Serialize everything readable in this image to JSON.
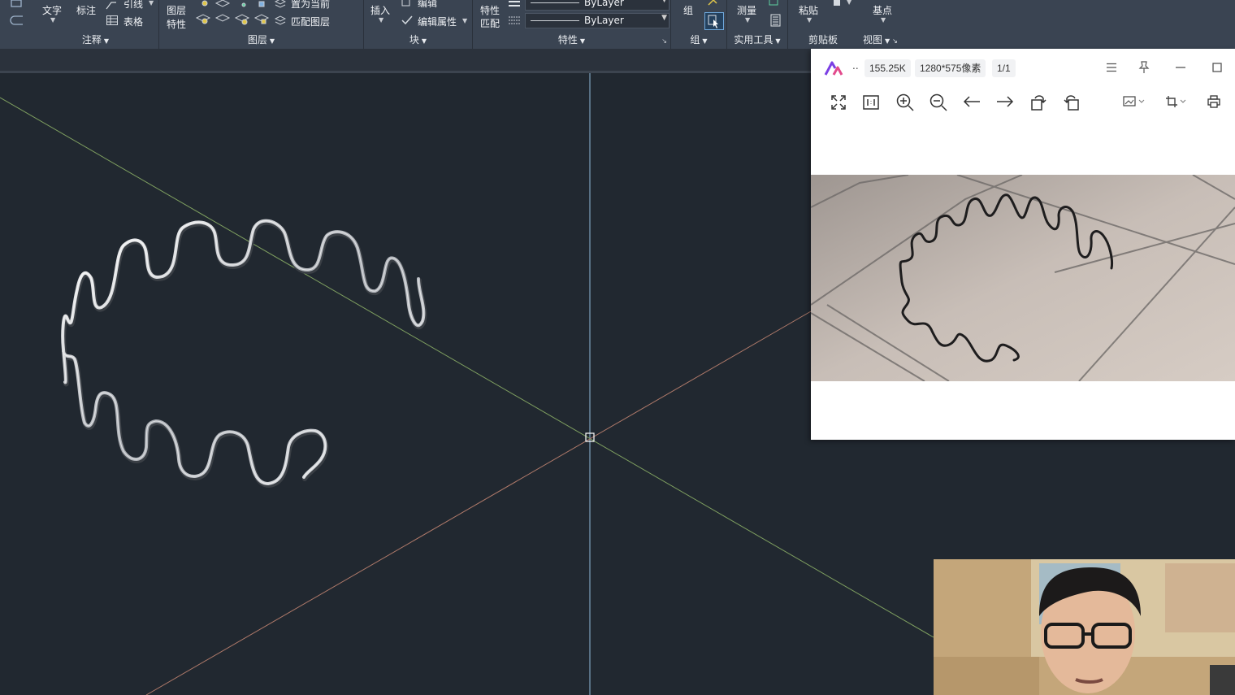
{
  "ribbon": {
    "annotation": {
      "text_label": "文字",
      "dim_label": "标注",
      "leader_label": "引线",
      "table_label": "表格",
      "title": "注释"
    },
    "layers": {
      "props_label_1": "图层",
      "props_label_2": "特性",
      "set_current_label": "置为当前",
      "match_layer_label": "匹配图层",
      "title": "图层"
    },
    "block": {
      "insert_label": "插入",
      "edit_label": "编辑",
      "edit_attr_label": "编辑属性",
      "title": "块"
    },
    "properties": {
      "match_label_1": "特性",
      "match_label_2": "匹配",
      "dropdown_1": "ByLayer",
      "dropdown_2": "ByLayer",
      "title": "特性"
    },
    "groups": {
      "group_label": "组",
      "title": "组"
    },
    "utilities": {
      "measure_label": "测量",
      "title": "实用工具"
    },
    "clipboard": {
      "paste_label": "粘贴",
      "title": "剪贴板"
    },
    "view": {
      "base_label": "基点",
      "title": "视图"
    }
  },
  "viewer": {
    "nav_dots": "..",
    "file_size": "155.25K",
    "dimensions": "1280*575像素",
    "page": "1/1",
    "toolbar_icons": [
      "fullscreen-icon",
      "actual-size-icon",
      "zoom-in-icon",
      "zoom-out-icon",
      "previous-icon",
      "next-icon",
      "rotate-left-icon",
      "rotate-right-icon",
      "edit-image-icon",
      "crop-icon",
      "print-icon"
    ],
    "window_icons": [
      "menu-icon",
      "pin-icon",
      "minimize-icon",
      "maximize-icon"
    ]
  },
  "colors": {
    "canvas_bg": "#212830",
    "ribbon_bg": "#3a4452",
    "ucs_y_axis": "#8fb7d9",
    "ucs_x_axis_green": "#7fa060",
    "ucs_x_axis_red": "#b07a6a",
    "brand": "#7b3fe4"
  }
}
